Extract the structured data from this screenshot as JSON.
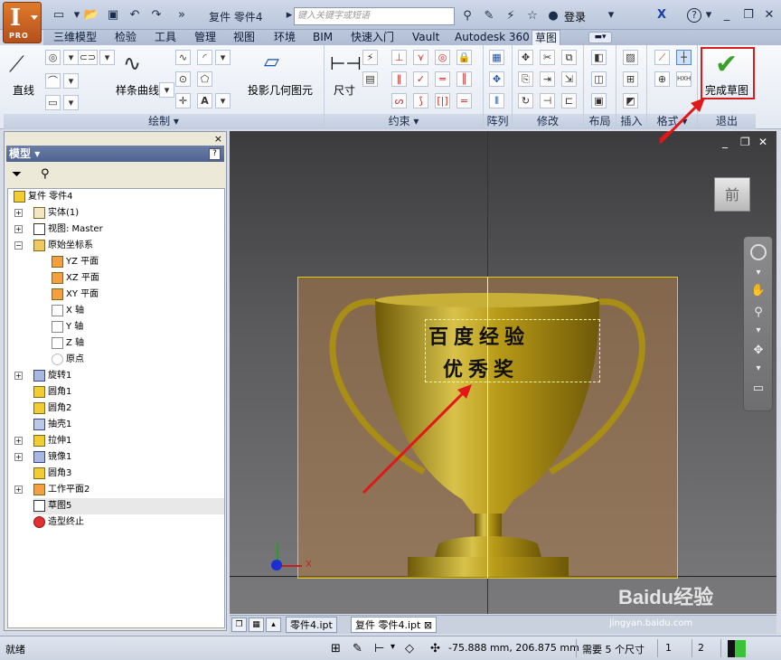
{
  "app": {
    "logo_letter": "I",
    "logo_edition": "PRO"
  },
  "titlebar": {
    "doc_title": "复件 零件4",
    "search_placeholder": "键入关键字或短语",
    "login": "登录"
  },
  "ribbon_tabs": [
    {
      "label": "三维模型"
    },
    {
      "label": "检验"
    },
    {
      "label": "工具"
    },
    {
      "label": "管理"
    },
    {
      "label": "视图"
    },
    {
      "label": "环境"
    },
    {
      "label": "BIM"
    },
    {
      "label": "快速入门"
    },
    {
      "label": "Vault"
    },
    {
      "label": "Autodesk 360"
    },
    {
      "label": "草图"
    }
  ],
  "ribbon": {
    "line_label": "直线",
    "spline_label": "样条曲线",
    "project_label": "投影几何图元",
    "dimension_label": "尺寸",
    "finish_label": "完成草图",
    "groups": {
      "draw": "绘制",
      "constrain": "约束",
      "pattern": "阵列",
      "modify": "修改",
      "layout": "布局",
      "insert": "插入",
      "format": "格式",
      "exit": "退出"
    }
  },
  "browser": {
    "title": "模型",
    "help": "?",
    "close": "×",
    "nodes": [
      {
        "label": "复件 零件4"
      },
      {
        "label": "实体(1)"
      },
      {
        "label": "视图: Master"
      },
      {
        "label": "原始坐标系"
      },
      {
        "label": "YZ 平面"
      },
      {
        "label": "XZ 平面"
      },
      {
        "label": "XY 平面"
      },
      {
        "label": "X 轴"
      },
      {
        "label": "Y 轴"
      },
      {
        "label": "Z 轴"
      },
      {
        "label": "原点"
      },
      {
        "label": "旋转1"
      },
      {
        "label": "圆角1"
      },
      {
        "label": "圆角2"
      },
      {
        "label": "抽壳1"
      },
      {
        "label": "拉伸1"
      },
      {
        "label": "镜像1"
      },
      {
        "label": "圆角3"
      },
      {
        "label": "工作平面2"
      },
      {
        "label": "草图5"
      },
      {
        "label": "造型终止"
      }
    ]
  },
  "viewport": {
    "viewcube_face": "前",
    "sketch_text_line1": "百度经验",
    "sketch_text_line2": "优秀奖",
    "axis_label": "X"
  },
  "doc_tabs": [
    {
      "label": "零件4.ipt"
    },
    {
      "label": "复件 零件4.ipt"
    }
  ],
  "status": {
    "ready": "就绪",
    "coords": "-75.888 mm, 206.875 mm",
    "dims_needed": "需要 5 个尺寸",
    "n1": "1",
    "n2": "2"
  },
  "watermark": {
    "brand": "Baidu经验",
    "url": "jingyan.baidu.com"
  }
}
